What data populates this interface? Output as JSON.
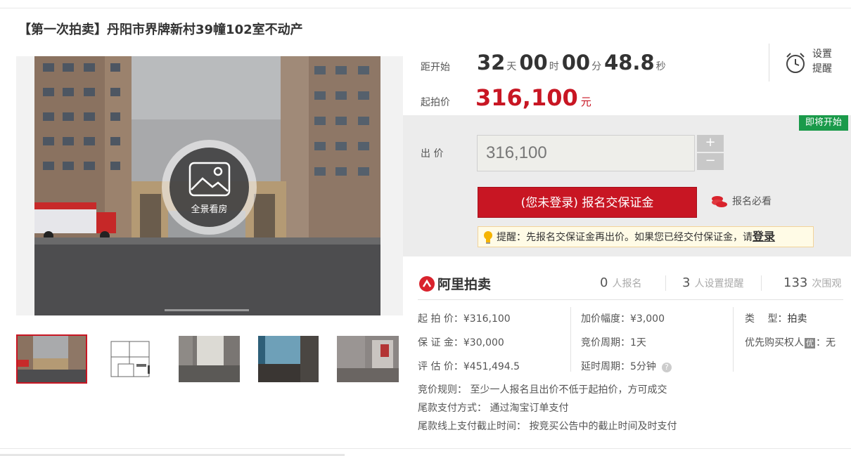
{
  "title": "【第一次拍卖】丹阳市界牌新村39幢102室不动产",
  "gallery": {
    "panorama_label": "全景看房"
  },
  "countdown": {
    "label": "距开始",
    "days": "32",
    "days_unit": "天",
    "hours": "00",
    "hours_unit": "时",
    "minutes": "00",
    "minutes_unit": "分",
    "seconds": "48.8",
    "seconds_unit": "秒"
  },
  "remind": {
    "line1": "设置",
    "line2": "提醒"
  },
  "start_price": {
    "label": "起拍价",
    "value": "316,100",
    "unit": "元"
  },
  "bid": {
    "status_badge": "即将开始",
    "label": "出 价",
    "input_value": "316,100",
    "plus": "+",
    "minus": "−",
    "signup_button": "(您未登录) 报名交保证金",
    "must_see": "报名必看",
    "tip_text": "提醒：先报名交保证金再出价。如果您已经交付保证金，请",
    "tip_login": "登录"
  },
  "brand": {
    "name": "阿里拍卖"
  },
  "stats": [
    {
      "num": "0",
      "label": "人报名"
    },
    {
      "num": "3",
      "label": "人设置提醒"
    },
    {
      "num": "133",
      "label": "次围观"
    }
  ],
  "details": {
    "start_price": "起 拍 价：¥316,100",
    "deposit": "保 证 金：¥30,000",
    "appraisal": "评 估 价：¥451,494.5",
    "increment": "加价幅度：¥3,000",
    "period": "竞价周期：1天",
    "delay": "延时周期：5分钟",
    "type_label": "类　 型：",
    "type_value": "拍卖",
    "priority_before": "优先购买权人",
    "priority_badge": "优",
    "priority_after": "：无"
  },
  "rules": {
    "rule": "竞价规则： 至少一人报名且出价不低于起拍价，方可成交",
    "payment": "尾款支付方式： 通过淘宝订单支付",
    "deadline": "尾款线上支付截止时间： 按竞买公告中的截止时间及时支付"
  },
  "colors": {
    "accent": "#c81623",
    "badge_green": "#1a9a4a",
    "panel_bg": "#ececec"
  }
}
